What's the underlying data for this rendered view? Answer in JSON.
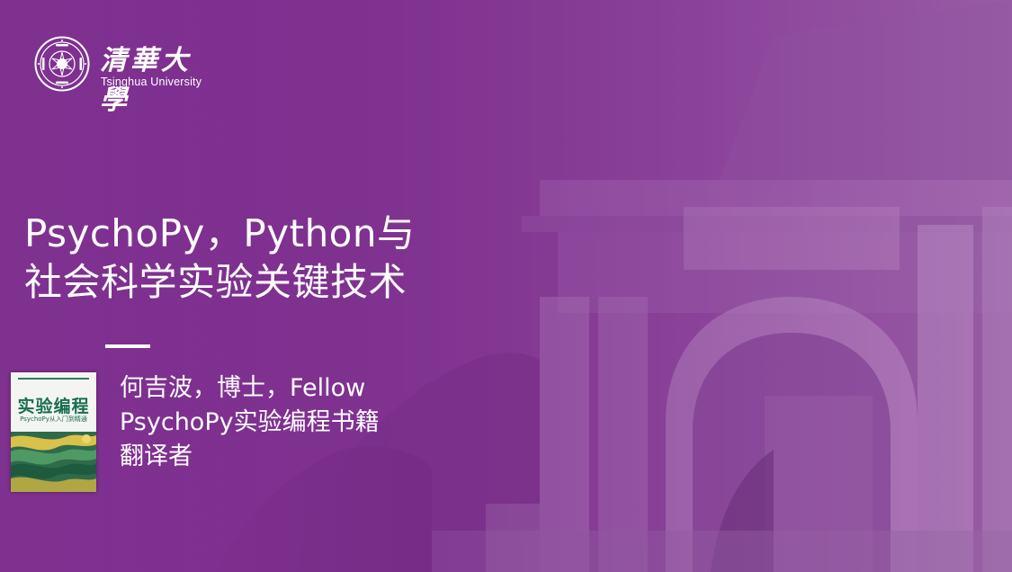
{
  "logo": {
    "name_cn": "清華大學",
    "name_en": "Tsinghua University"
  },
  "title": {
    "line1": "PsychoPy，Python与",
    "line2": "社会科学实验关键技术"
  },
  "book_cover": {
    "title": "实验编程",
    "subtitle": "PsychoPy从入门到精通"
  },
  "author": {
    "line1": "何吉波，博士，Fellow",
    "line2": "PsychoPy实验编程书籍",
    "line3": "翻译者"
  },
  "colors": {
    "background_purple": "#7f3190",
    "book_green": "#1a6e52",
    "text": "#ffffff"
  }
}
